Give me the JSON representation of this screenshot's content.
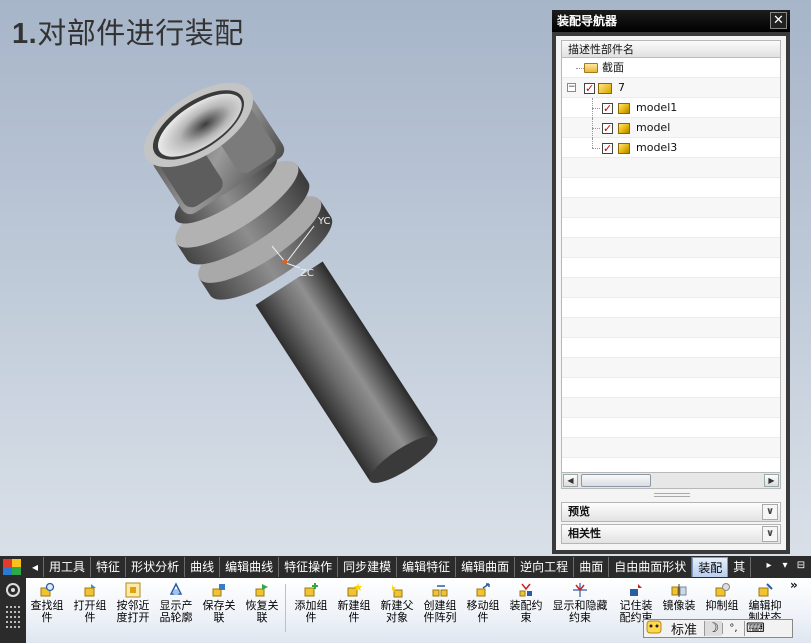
{
  "slide": {
    "number": "1.",
    "title": "对部件进行装配"
  },
  "viewport": {
    "wcs_y_label": "YC",
    "wcs_z_label": "ZC"
  },
  "navigator": {
    "title": "装配导航器",
    "column_header": "描述性部件名",
    "tree": [
      {
        "label": "截面",
        "icon": "folder-icon",
        "checked": null
      },
      {
        "label": "7",
        "icon": "assembly-icon",
        "checked": true,
        "expander": "−"
      },
      {
        "label": "model1",
        "icon": "part-icon",
        "checked": true
      },
      {
        "label": "model",
        "icon": "part-icon",
        "checked": true
      },
      {
        "label": "model3",
        "icon": "part-icon",
        "checked": true
      }
    ],
    "sections": [
      {
        "label": "预览"
      },
      {
        "label": "相关性"
      }
    ],
    "chevron": "∨",
    "close": "✕"
  },
  "ribbon": {
    "tabs": [
      "◂",
      "用工具",
      "特征",
      "形状分析",
      "曲线",
      "编辑曲线",
      "特征操作",
      "同步建模",
      "编辑特征",
      "编辑曲面",
      "逆向工程",
      "曲面",
      "自由曲面形状",
      "装配",
      "其"
    ],
    "active_tab": "装配",
    "tab_right": [
      "▸",
      "▾",
      "⊟"
    ],
    "more": "»",
    "tools": [
      {
        "label": "查找组件",
        "icon": "find-component-icon"
      },
      {
        "label": "打开组件",
        "icon": "open-component-icon"
      },
      {
        "label": "按邻近度打开",
        "icon": "open-by-proximity-icon"
      },
      {
        "label": "显示产品轮廓",
        "icon": "show-product-outline-icon"
      },
      {
        "label": "保存关联",
        "icon": "save-association-icon"
      },
      {
        "label": "恢复关联",
        "icon": "restore-association-icon"
      },
      {
        "label": "添加组件",
        "icon": "add-component-icon"
      },
      {
        "label": "新建组件",
        "icon": "new-component-icon"
      },
      {
        "label": "新建父对象",
        "icon": "new-parent-icon"
      },
      {
        "label": "创建组件阵列",
        "icon": "component-array-icon"
      },
      {
        "label": "移动组件",
        "icon": "move-component-icon"
      },
      {
        "label": "装配约束",
        "icon": "assembly-constraint-icon"
      },
      {
        "label": "显示和隐藏约束",
        "icon": "show-hide-constraints-icon"
      },
      {
        "label": "记住装配约束",
        "icon": "remember-constraints-icon"
      },
      {
        "label": "镜像装",
        "icon": "mirror-assembly-icon"
      },
      {
        "label": "抑制组",
        "icon": "suppress-component-icon"
      },
      {
        "label": "编辑抑制状态",
        "icon": "edit-suppression-icon"
      }
    ],
    "ime": {
      "mode": "标准",
      "moon": "☽",
      "punct": "°,",
      "keyboard": "⌨"
    }
  }
}
